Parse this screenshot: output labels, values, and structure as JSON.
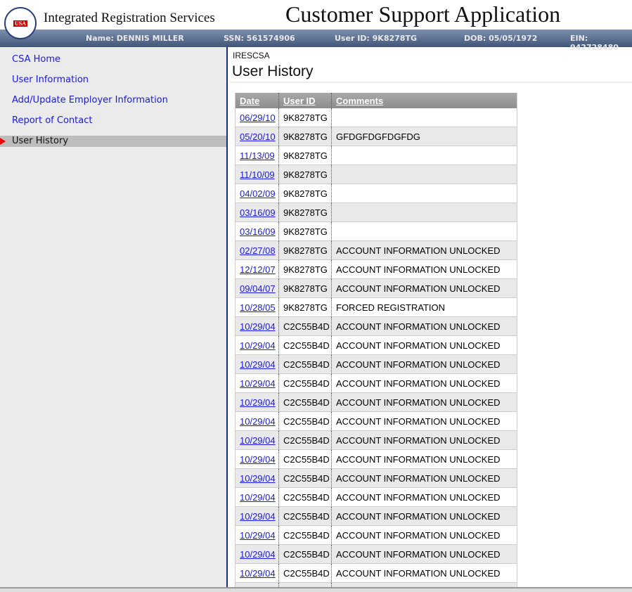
{
  "header": {
    "org": "Integrated Registration Services",
    "app_title": "Customer Support Application",
    "seal_text": "USA"
  },
  "info": {
    "name": "Name: DENNIS MILLER",
    "ssn": "SSN: 561574906",
    "user_id": "User ID: 9K8278TG",
    "dob": "DOB: 05/05/1972",
    "ein": "EIN: 942728480"
  },
  "sidebar": {
    "items": [
      {
        "label": "CSA Home"
      },
      {
        "label": "User Information"
      },
      {
        "label": "Add/Update Employer Information"
      },
      {
        "label": "Report of Contact"
      },
      {
        "label": "User History"
      }
    ]
  },
  "main": {
    "breadcrumb": "IRESCSA",
    "title": "User History"
  },
  "table": {
    "headers": [
      "Date",
      "User ID",
      "Comments"
    ],
    "rows": [
      [
        "06/29/10",
        "9K8278TG",
        ""
      ],
      [
        "05/20/10",
        "9K8278TG",
        "GFDGFDGFDGFDG"
      ],
      [
        "11/13/09",
        "9K8278TG",
        ""
      ],
      [
        "11/10/09",
        "9K8278TG",
        ""
      ],
      [
        "04/02/09",
        "9K8278TG",
        ""
      ],
      [
        "03/16/09",
        "9K8278TG",
        ""
      ],
      [
        "03/16/09",
        "9K8278TG",
        ""
      ],
      [
        "02/27/08",
        "9K8278TG",
        "ACCOUNT INFORMATION UNLOCKED"
      ],
      [
        "12/12/07",
        "9K8278TG",
        "ACCOUNT INFORMATION UNLOCKED"
      ],
      [
        "09/04/07",
        "9K8278TG",
        "ACCOUNT INFORMATION UNLOCKED"
      ],
      [
        "10/28/05",
        "9K8278TG",
        "FORCED REGISTRATION"
      ],
      [
        "10/29/04",
        "C2C55B4D",
        "ACCOUNT INFORMATION UNLOCKED"
      ],
      [
        "10/29/04",
        "C2C55B4D",
        "ACCOUNT INFORMATION UNLOCKED"
      ],
      [
        "10/29/04",
        "C2C55B4D",
        "ACCOUNT INFORMATION UNLOCKED"
      ],
      [
        "10/29/04",
        "C2C55B4D",
        "ACCOUNT INFORMATION UNLOCKED"
      ],
      [
        "10/29/04",
        "C2C55B4D",
        "ACCOUNT INFORMATION UNLOCKED"
      ],
      [
        "10/29/04",
        "C2C55B4D",
        "ACCOUNT INFORMATION UNLOCKED"
      ],
      [
        "10/29/04",
        "C2C55B4D",
        "ACCOUNT INFORMATION UNLOCKED"
      ],
      [
        "10/29/04",
        "C2C55B4D",
        "ACCOUNT INFORMATION UNLOCKED"
      ],
      [
        "10/29/04",
        "C2C55B4D",
        "ACCOUNT INFORMATION UNLOCKED"
      ],
      [
        "10/29/04",
        "C2C55B4D",
        "ACCOUNT INFORMATION UNLOCKED"
      ],
      [
        "10/29/04",
        "C2C55B4D",
        "ACCOUNT INFORMATION UNLOCKED"
      ],
      [
        "10/29/04",
        "C2C55B4D",
        "ACCOUNT INFORMATION UNLOCKED"
      ],
      [
        "10/29/04",
        "C2C55B4D",
        "ACCOUNT INFORMATION UNLOCKED"
      ],
      [
        "10/29/04",
        "C2C55B4D",
        "ACCOUNT INFORMATION UNLOCKED"
      ]
    ]
  }
}
